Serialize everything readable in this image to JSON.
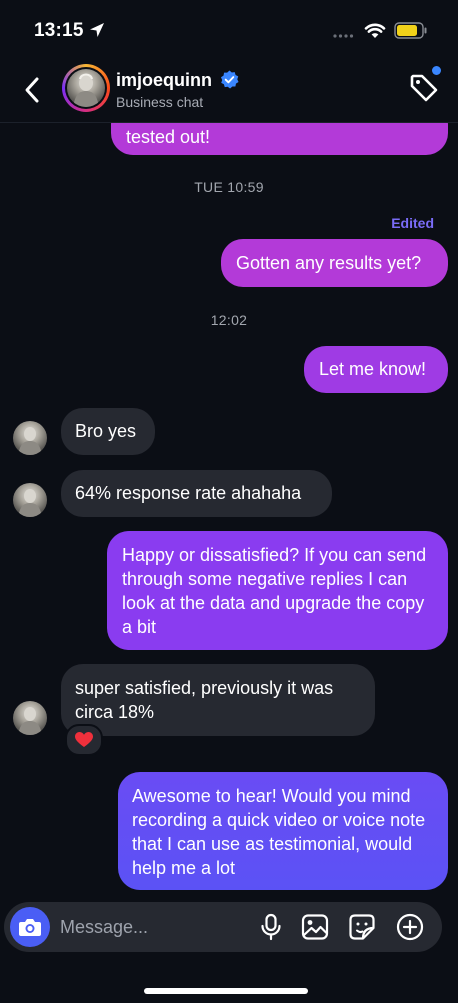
{
  "status_bar": {
    "time": "13:15",
    "icons": [
      "location-arrow-icon",
      "cellular-signal-icon",
      "wifi-icon",
      "battery-icon"
    ],
    "battery_color": "#f2d21a"
  },
  "header": {
    "username": "imjoequinn",
    "subtitle": "Business chat",
    "icons": [
      "back-chevron-icon",
      "verified-badge-icon",
      "tag-icon"
    ],
    "verified_color": "#3a86ff",
    "notification_dot_color": "#3a86ff"
  },
  "conversation": {
    "messages": [
      {
        "type": "outgoing",
        "text": "tested out!"
      },
      {
        "type": "timestamp",
        "text": "TUE 10:59"
      },
      {
        "type": "edited_label",
        "text": "Edited"
      },
      {
        "type": "outgoing",
        "text": "Gotten any results yet?"
      },
      {
        "type": "timestamp",
        "text": "12:02"
      },
      {
        "type": "outgoing",
        "text": "Let me know!"
      },
      {
        "type": "incoming",
        "text": "Bro yes"
      },
      {
        "type": "incoming",
        "text": "64% response rate ahahaha"
      },
      {
        "type": "outgoing",
        "text": "Happy or dissatisfied? If you can send through some negative replies I can look at the data and upgrade the copy a bit"
      },
      {
        "type": "incoming",
        "text": "super satisfied, previously it was circa 18%",
        "reaction": "❤️"
      },
      {
        "type": "outgoing",
        "text": "Awesome to hear! Would you mind recording a quick video or voice note that I can use as testimonial, would help me a lot"
      }
    ],
    "colors": {
      "outgoing_top": "#b33ad8",
      "outgoing_mid": "#8a3cf0",
      "outgoing_bottom": "#5b52f5",
      "incoming": "#262931"
    }
  },
  "composer": {
    "placeholder": "Message...",
    "icons": [
      "camera-icon",
      "microphone-icon",
      "gallery-icon",
      "sticker-icon",
      "add-icon"
    ],
    "camera_color": "#4a5ef5"
  }
}
